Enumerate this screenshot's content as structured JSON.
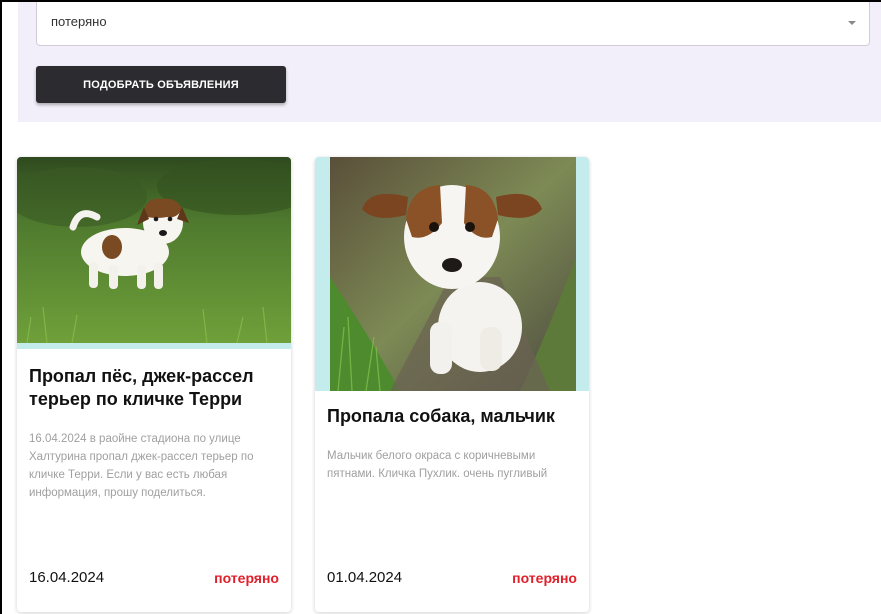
{
  "filter": {
    "status_value": "потеряно",
    "search_button_label": "подобрать объявления"
  },
  "cards": [
    {
      "title": "Пропал пёс, джек-рассел терьер по кличке Терри",
      "description": "16.04.2024 в раойне стадиона по улице Халтурина пропал джек-рассел терьер по кличке Терри. Если у вас есть любая информация, прошу поделиться.",
      "date": "16.04.2024",
      "status": "потеряно"
    },
    {
      "title": "Пропала собака, мальчик",
      "description": "Мальчик белого окраса с коричневыми пятнами. Кличка Пухлик. очень пугливый",
      "date": "01.04.2024",
      "status": "потеряно"
    }
  ],
  "colors": {
    "panel_bg": "#f3effa",
    "button_bg": "#2c2c30",
    "status_red": "#e0202a",
    "media_accent": "#c5ecec"
  }
}
